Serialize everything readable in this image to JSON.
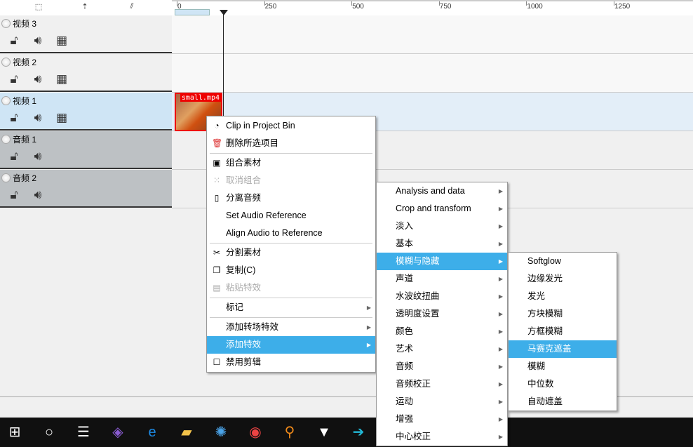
{
  "toolbar": {
    "icons": [
      "insert-down-icon",
      "lift-up-icon",
      "spacer-icon"
    ]
  },
  "ruler": {
    "ticks": [
      "0",
      "250",
      "500",
      "750",
      "1000",
      "1250"
    ]
  },
  "tracks": [
    {
      "name": "视频 3",
      "type": "video",
      "selected": false
    },
    {
      "name": "视频 2",
      "type": "video",
      "selected": false
    },
    {
      "name": "视频 1",
      "type": "video",
      "selected": true
    },
    {
      "name": "音频 1",
      "type": "audio",
      "selected": false
    },
    {
      "name": "音频 2",
      "type": "audio",
      "selected": false
    }
  ],
  "clip": {
    "label": "small.mp4",
    "border_color": "#ee0000"
  },
  "context_menu": {
    "items": [
      {
        "label": "Clip in Project Bin",
        "icon": "clip-bin-icon"
      },
      {
        "label": "删除所选项目",
        "icon": "trash-icon"
      },
      {
        "sep": true
      },
      {
        "label": "组合素材",
        "icon": "group-icon"
      },
      {
        "label": "取消组合",
        "icon": "ungroup-icon",
        "disabled": true
      },
      {
        "label": "分离音频",
        "icon": "page-icon"
      },
      {
        "label": "Set Audio Reference"
      },
      {
        "label": "Align Audio to Reference"
      },
      {
        "sep": true
      },
      {
        "label": "分割素材",
        "icon": "scissors-icon"
      },
      {
        "label": "复制(C)",
        "icon": "copy-icon"
      },
      {
        "label": "粘贴特效",
        "icon": "paste-icon",
        "disabled": true
      },
      {
        "sep": true
      },
      {
        "label": "标记",
        "submenu": true
      },
      {
        "sep": true
      },
      {
        "label": "添加转场特效",
        "submenu": true
      },
      {
        "label": "添加特效",
        "submenu": true,
        "highlighted": true
      },
      {
        "label": "禁用剪辑",
        "icon": "checkbox-icon"
      }
    ]
  },
  "effects_menu": {
    "items": [
      "Analysis and data",
      "Crop and transform",
      "淡入",
      "基本",
      "模糊与隐藏",
      "声道",
      "水波纹扭曲",
      "透明度设置",
      "颜色",
      "艺术",
      "音频",
      "音频校正",
      "运动",
      "增强",
      "中心校正"
    ],
    "highlighted": "模糊与隐藏"
  },
  "blur_menu": {
    "items": [
      "Softglow",
      "边缘发光",
      "发光",
      "方块模糊",
      "方框模糊",
      "马赛克遮盖",
      "模糊",
      "中位数",
      "自动遮盖"
    ],
    "highlighted": "马赛克遮盖"
  },
  "taskbar": {
    "icons": [
      "windows-start-icon",
      "cortana-icon",
      "task-view-icon",
      "visual-studio-icon",
      "edge-icon",
      "file-explorer-icon",
      "safari-icon",
      "chrome-icon",
      "search-doc-icon",
      "alien-icon",
      "app-arrow-icon"
    ]
  },
  "colors": {
    "highlight": "#3daee9",
    "selected_track": "#cfe5f5",
    "audio_track": "#bdc1c4"
  }
}
